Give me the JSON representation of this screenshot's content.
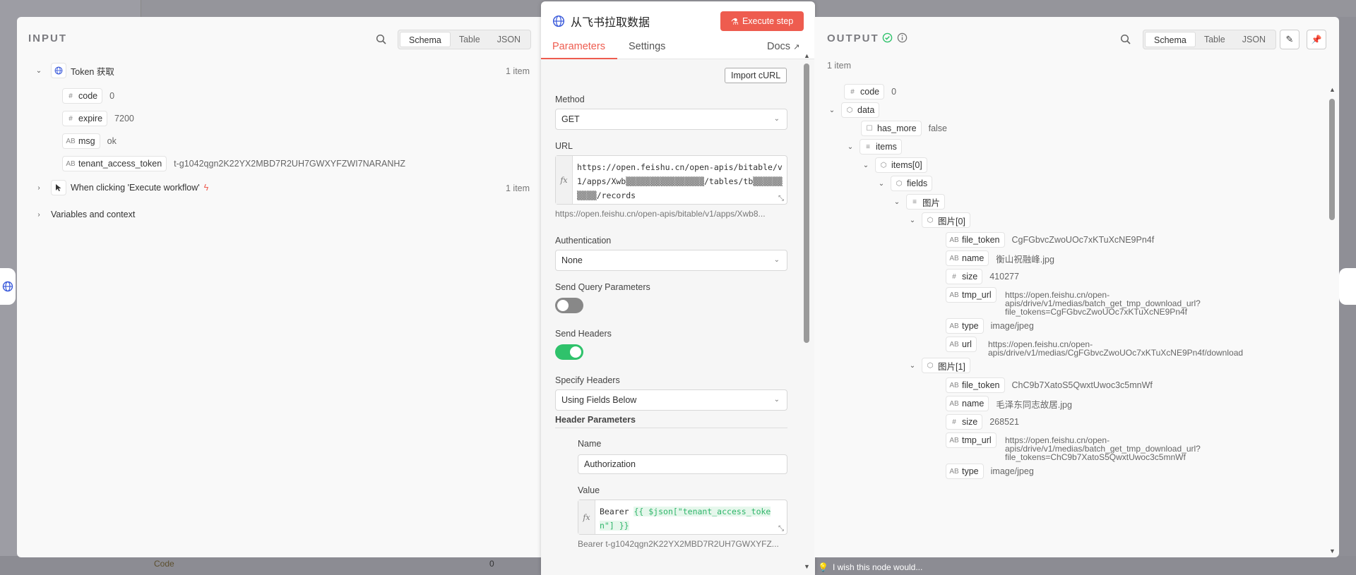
{
  "background": {
    "code_label": "Code",
    "code_value": "0"
  },
  "input": {
    "title": "INPUT",
    "views": [
      "Schema",
      "Table",
      "JSON"
    ],
    "active_view": "Schema",
    "nodes": [
      {
        "name": "Token 获取",
        "count": "1 item"
      },
      {
        "name": "When clicking 'Execute workflow'",
        "count": "1 item"
      },
      {
        "name": "Variables and context"
      }
    ],
    "fields": [
      {
        "type": "#",
        "key": "code",
        "value": "0"
      },
      {
        "type": "#",
        "key": "expire",
        "value": "7200"
      },
      {
        "type": "AB",
        "key": "msg",
        "value": "ok"
      },
      {
        "type": "AB",
        "key": "tenant_access_token",
        "value": "t-g1042qgn2K22YX2MBD7R2UH7GWXYFZWI7NARANHZ"
      }
    ]
  },
  "params": {
    "title": "从飞书拉取数据",
    "execute_label": "Execute step",
    "tabs": [
      "Parameters",
      "Settings"
    ],
    "docs_label": "Docs",
    "import_curl": "Import cURL",
    "method_label": "Method",
    "method_value": "GET",
    "url_label": "URL",
    "url_value": "https://open.feishu.cn/open-apis/bitable/v1/apps/Xwb▒▒▒▒▒▒▒▒▒▒▒▒▒▒▒▒/tables/tb▒▒▒▒▒▒▒▒▒▒/records",
    "url_preview": "https://open.feishu.cn/open-apis/bitable/v1/apps/Xwb8...",
    "auth_label": "Authentication",
    "auth_value": "None",
    "send_query_label": "Send Query Parameters",
    "send_query_on": false,
    "send_headers_label": "Send Headers",
    "send_headers_on": true,
    "specify_headers_label": "Specify Headers",
    "specify_headers_value": "Using Fields Below",
    "header_params_label": "Header Parameters",
    "header_name_label": "Name",
    "header_name_value": "Authorization",
    "header_value_label": "Value",
    "header_value_prefix": "Bearer",
    "header_value_expr": "{{ $json[\"tenant_access_token\"] }}",
    "header_value_preview": "Bearer t-g1042qgn2K22YX2MBD7R2UH7GWXYFZ...",
    "feedback": "I wish this node would...",
    "colors": {
      "accent": "#ee5c4f",
      "toggle_on": "#2fc26b",
      "toggle_off": "#888888"
    }
  },
  "output": {
    "title": "OUTPUT",
    "views": [
      "Schema",
      "Table",
      "JSON"
    ],
    "active_view": "Schema",
    "count": "1 item",
    "rows": [
      {
        "type": "#",
        "key": "code",
        "value": "0"
      },
      {
        "type": "obj",
        "key": "data"
      },
      {
        "type": "bool",
        "key": "has_more",
        "value": "false"
      },
      {
        "type": "list",
        "key": "items"
      },
      {
        "type": "obj",
        "key": "items[0]"
      },
      {
        "type": "obj",
        "key": "fields"
      },
      {
        "type": "list",
        "key": "图片"
      },
      {
        "type": "obj",
        "key": "图片[0]"
      },
      {
        "type": "AB",
        "key": "file_token",
        "value": "CgFGbvcZwoUOc7xKTuXcNE9Pn4f"
      },
      {
        "type": "AB",
        "key": "name",
        "value": "衡山祝融峰.jpg"
      },
      {
        "type": "#",
        "key": "size",
        "value": "410277"
      },
      {
        "type": "AB",
        "key": "tmp_url",
        "value_lines": [
          "https://open.feishu.cn/open-",
          "apis/drive/v1/medias/batch_get_tmp_download_url?",
          "file_tokens=CgFGbvcZwoUOc7xKTuXcNE9Pn4f"
        ]
      },
      {
        "type": "AB",
        "key": "type",
        "value": "image/jpeg"
      },
      {
        "type": "AB",
        "key": "url",
        "value_lines": [
          "https://open.feishu.cn/open-",
          "apis/drive/v1/medias/CgFGbvcZwoUOc7xKTuXcNE9Pn4f/download"
        ]
      },
      {
        "type": "obj",
        "key": "图片[1]"
      },
      {
        "type": "AB",
        "key": "file_token",
        "value": "ChC9b7XatoS5QwxtUwoc3c5mnWf"
      },
      {
        "type": "AB",
        "key": "name",
        "value": "毛泽东同志故居.jpg"
      },
      {
        "type": "#",
        "key": "size",
        "value": "268521"
      },
      {
        "type": "AB",
        "key": "tmp_url",
        "value_lines": [
          "https://open.feishu.cn/open-",
          "apis/drive/v1/medias/batch_get_tmp_download_url?",
          "file_tokens=ChC9b7XatoS5QwxtUwoc3c5mnWf"
        ]
      },
      {
        "type": "AB",
        "key": "type",
        "value": "image/jpeg"
      }
    ]
  }
}
